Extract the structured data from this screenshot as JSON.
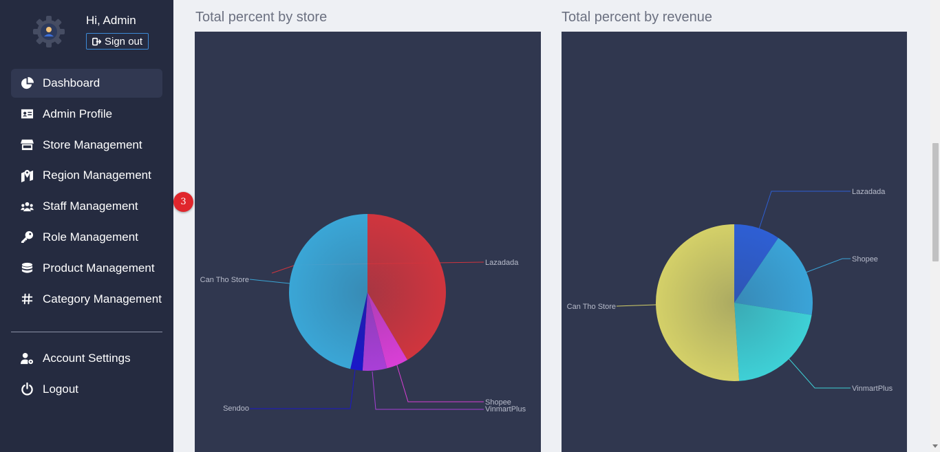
{
  "sidebar": {
    "greeting": "Hi, Admin",
    "signout_label": "Sign out",
    "items": [
      {
        "label": "Dashboard",
        "icon": "pie-chart-icon",
        "active": true
      },
      {
        "label": "Admin Profile",
        "icon": "id-card-icon"
      },
      {
        "label": "Store Management",
        "icon": "store-icon"
      },
      {
        "label": "Region Management",
        "icon": "map-marker-icon"
      },
      {
        "label": "Staff Management",
        "icon": "users-icon"
      },
      {
        "label": "Role Management",
        "icon": "key-icon"
      },
      {
        "label": "Product Management",
        "icon": "database-icon"
      },
      {
        "label": "Category Management",
        "icon": "hashtag-icon"
      }
    ],
    "bottom_items": [
      {
        "label": "Account Settings",
        "icon": "user-gear-icon"
      },
      {
        "label": "Logout",
        "icon": "power-icon"
      }
    ]
  },
  "notification_badge": "3",
  "panels": {
    "store": {
      "title": "Total percent by store"
    },
    "revenue": {
      "title": "Total percent by revenue"
    }
  },
  "chart_data": [
    {
      "type": "pie",
      "title": "Total percent by store",
      "categories": [
        "Lazadada",
        "Shopee",
        "VinmartPlus",
        "Sendoo",
        "Can Tho Store"
      ],
      "values": [
        41.5,
        4.5,
        5.0,
        2.5,
        46.5
      ],
      "colors": [
        "#d0353e",
        "#d93fd6",
        "#a93fd7",
        "#1a17c9",
        "#3aa6d6"
      ]
    },
    {
      "type": "pie",
      "title": "Total percent by revenue",
      "categories": [
        "Lazadada",
        "Shopee",
        "VinmartPlus",
        "Can Tho Store"
      ],
      "values": [
        9.5,
        18.0,
        21.5,
        51.0
      ],
      "colors": [
        "#2e5fd4",
        "#3aa4d8",
        "#3ed0d6",
        "#d4d068"
      ]
    }
  ]
}
